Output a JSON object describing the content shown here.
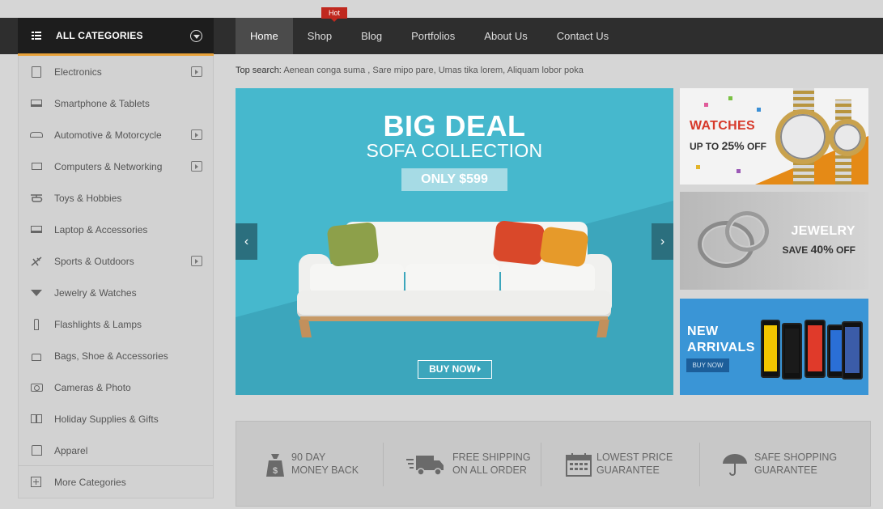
{
  "header": {
    "all_categories_label": "ALL CATEGORIES",
    "hot_badge": "Hot",
    "menu": [
      {
        "label": "Home",
        "active": true
      },
      {
        "label": "Shop",
        "active": false
      },
      {
        "label": "Blog",
        "active": false
      },
      {
        "label": "Portfolios",
        "active": false
      },
      {
        "label": "About Us",
        "active": false
      },
      {
        "label": "Contact Us",
        "active": false
      }
    ]
  },
  "sidebar": {
    "items": [
      {
        "label": "Electronics",
        "icon": "box-icon",
        "has_submenu": true
      },
      {
        "label": "Smartphone & Tablets",
        "icon": "laptop-icon",
        "has_submenu": false
      },
      {
        "label": "Automotive & Motorcycle",
        "icon": "car-icon",
        "has_submenu": true
      },
      {
        "label": "Computers & Networking",
        "icon": "monitor-icon",
        "has_submenu": true
      },
      {
        "label": "Toys & Hobbies",
        "icon": "helicopter-icon",
        "has_submenu": false
      },
      {
        "label": "Laptop & Accessories",
        "icon": "laptop-icon",
        "has_submenu": false
      },
      {
        "label": "Sports & Outdoors",
        "icon": "sports-icon",
        "has_submenu": true
      },
      {
        "label": "Jewelry & Watches",
        "icon": "diamond-icon",
        "has_submenu": false
      },
      {
        "label": "Flashlights & Lamps",
        "icon": "flashlight-icon",
        "has_submenu": false
      },
      {
        "label": "Bags, Shoe & Accessories",
        "icon": "bag-icon",
        "has_submenu": false
      },
      {
        "label": "Cameras & Photo",
        "icon": "camera-icon",
        "has_submenu": false
      },
      {
        "label": "Holiday Supplies & Gifts",
        "icon": "gift-icon",
        "has_submenu": false
      },
      {
        "label": "Apparel",
        "icon": "shirt-icon",
        "has_submenu": false
      }
    ],
    "more_label": "More Categories"
  },
  "top_search": {
    "label": "Top search:",
    "terms": "Aenean conga suma , Sare mipo pare, Umas tika lorem, Aliquam lobor poka"
  },
  "hero": {
    "title": "BIG DEAL",
    "subtitle": "SOFA COLLECTION",
    "price": "ONLY $599",
    "button": "BUY NOW",
    "prev_glyph": "‹",
    "next_glyph": "›"
  },
  "banners": {
    "watches": {
      "title": "WATCHES",
      "sub_prefix": "UP TO ",
      "sub_value": "25%",
      "sub_suffix": " OFF"
    },
    "jewelry": {
      "title": "JEWELRY",
      "sub_prefix": "SAVE ",
      "sub_value": "40%",
      "sub_suffix": " OFF"
    },
    "arrivals": {
      "title_line1": "NEW",
      "title_line2": "ARRIVALS",
      "button": "BUY NOW"
    }
  },
  "services": [
    {
      "line1": "90 DAY",
      "line2": "MONEY BACK",
      "icon": "money-bag-icon"
    },
    {
      "line1": "FREE SHIPPING",
      "line2": "ON ALL ORDER",
      "icon": "truck-icon"
    },
    {
      "line1": "LOWEST PRICE",
      "line2": "GUARANTEE",
      "icon": "calendar-icon"
    },
    {
      "line1": "SAFE SHOPPING",
      "line2": "GUARANTEE",
      "icon": "umbrella-icon"
    }
  ],
  "colors": {
    "nav_bg": "#2e2e2e",
    "accent_orange": "#e8a23a",
    "hero_bg": "#46b8cd",
    "hot_red": "#c0281e",
    "arrivals_blue": "#3a95d6"
  }
}
